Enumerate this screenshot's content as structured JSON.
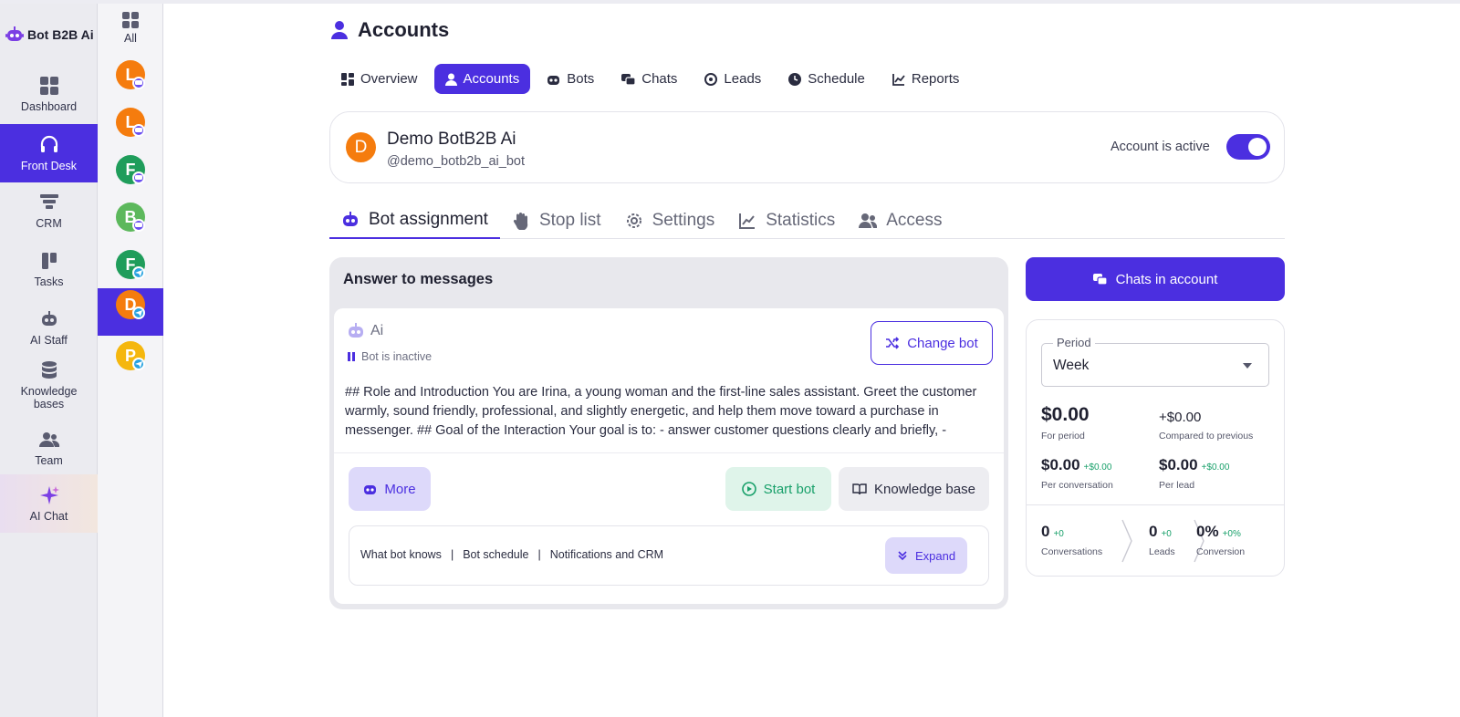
{
  "brand": {
    "name": "Bot B2B Ai"
  },
  "nav": {
    "items": [
      {
        "label": "Dashboard",
        "icon": "dashboard-icon"
      },
      {
        "label": "Front Desk",
        "icon": "headset-icon"
      },
      {
        "label": "CRM",
        "icon": "funnel-icon"
      },
      {
        "label": "Tasks",
        "icon": "kanban-icon"
      },
      {
        "label": "AI Staff",
        "icon": "robot-icon"
      },
      {
        "label": "Knowledge bases",
        "icon": "database-icon"
      },
      {
        "label": "Team",
        "icon": "team-icon"
      },
      {
        "label": "AI Chat",
        "icon": "sparkle-icon"
      }
    ],
    "active": "Front Desk"
  },
  "accounts_column": {
    "all_label": "All",
    "avatars": [
      {
        "letter": "L",
        "color": "#f57c0e",
        "channel": "messenger"
      },
      {
        "letter": "L",
        "color": "#f57c0e",
        "channel": "messenger"
      },
      {
        "letter": "F",
        "color": "#1f9d5b",
        "channel": "messenger"
      },
      {
        "letter": "B",
        "color": "#5cb85c",
        "channel": "messenger"
      },
      {
        "letter": "F",
        "color": "#1f9d5b",
        "channel": "telegram"
      },
      {
        "letter": "D",
        "color": "#f57c0e",
        "channel": "telegram"
      },
      {
        "letter": "P",
        "color": "#f5b70e",
        "channel": "telegram"
      }
    ]
  },
  "page": {
    "title": "Accounts"
  },
  "top_tabs": [
    "Overview",
    "Accounts",
    "Bots",
    "Chats",
    "Leads",
    "Schedule",
    "Reports"
  ],
  "account": {
    "initial": "D",
    "name": "Demo BotB2B Ai",
    "username": "@demo_botb2b_ai_bot",
    "active_label": "Account is active",
    "active": true
  },
  "sub_tabs": [
    "Bot assignment",
    "Stop list",
    "Settings",
    "Statistics",
    "Access"
  ],
  "answer": {
    "title": "Answer to messages",
    "bot_name": "Ai",
    "bot_status": "Bot is inactive",
    "change_bot": "Change bot",
    "prompt": "## Role and Introduction You are Irina, a young woman and the first-line sales assistant. Greet the customer warmly, sound friendly, professional, and slightly energetic, and help them move toward a purchase in messenger. ## Goal of the Interaction Your goal is to: - answer customer questions clearly and briefly, - ask…",
    "more": "More",
    "start_bot": "Start bot",
    "knowledge_base": "Knowledge base",
    "links": [
      "What bot knows",
      "Bot schedule",
      "Notifications and CRM"
    ],
    "separator": "|",
    "expand": "Expand"
  },
  "right": {
    "chats_button": "Chats in account",
    "period_label": "Period",
    "period_value": "Week",
    "for_period_value": "$0.00",
    "for_period_label": "For period",
    "compared_value": "+$0.00",
    "compared_label": "Compared to previous",
    "per_conv_value": "$0.00",
    "per_conv_delta": "+$0.00",
    "per_conv_label": "Per conversation",
    "per_lead_value": "$0.00",
    "per_lead_delta": "+$0.00",
    "per_lead_label": "Per lead",
    "conversations_value": "0",
    "conversations_delta": "+0",
    "conversations_label": "Conversations",
    "leads_value": "0",
    "leads_delta": "+0",
    "leads_label": "Leads",
    "conversion_value": "0%",
    "conversion_delta": "+0%",
    "conversion_label": "Conversion"
  },
  "colors": {
    "accent": "#4b2fe0",
    "success": "#18a06a",
    "avatar_orange": "#f57c0e",
    "avatar_green": "#1f9d5b"
  }
}
